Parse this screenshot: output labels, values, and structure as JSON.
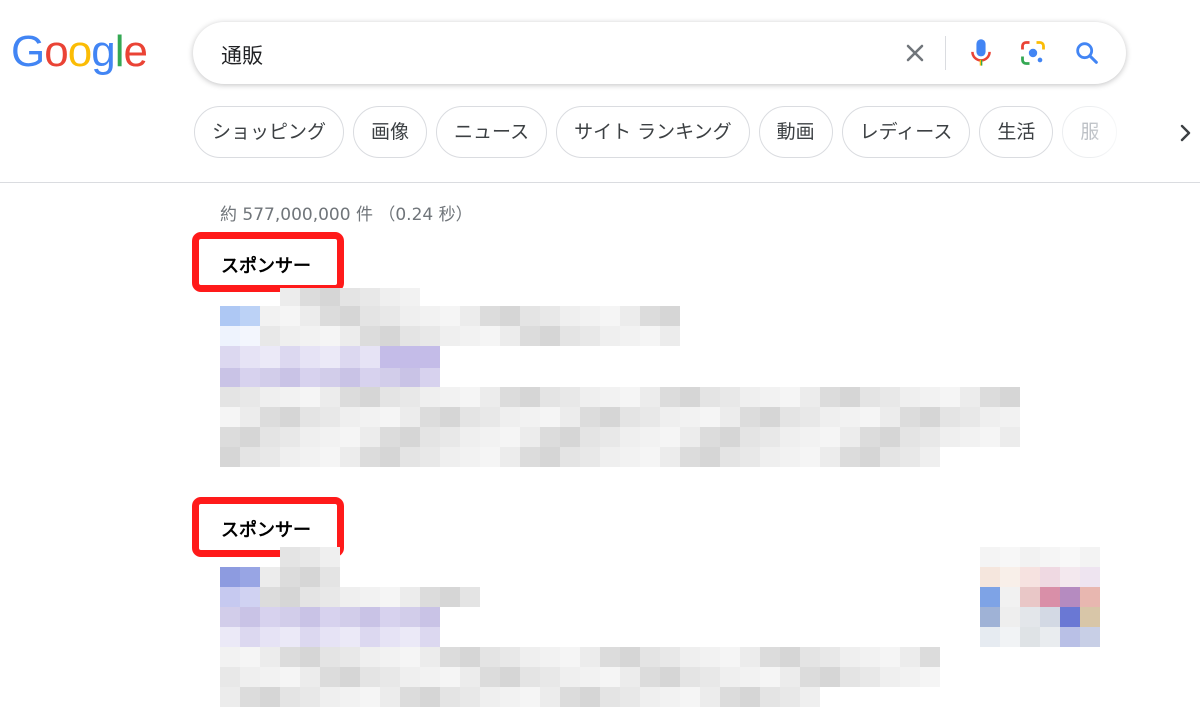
{
  "logo": {
    "letters": [
      "G",
      "o",
      "o",
      "g",
      "l",
      "e"
    ],
    "colors": [
      "#4285F4",
      "#EA4335",
      "#FBBC05",
      "#4285F4",
      "#34A853",
      "#EA4335"
    ]
  },
  "search": {
    "query": "通販",
    "icons": [
      "close-icon",
      "mic-icon",
      "lens-icon",
      "search-icon"
    ]
  },
  "chips": [
    "ショッピング",
    "画像",
    "ニュース",
    "サイト ランキング",
    "動画",
    "レディース",
    "生活",
    "服"
  ],
  "results": {
    "stats": "約 577,000,000 件 （0.24 秒）",
    "ads": [
      {
        "label": "スポンサー"
      },
      {
        "label": "スポンサー"
      }
    ]
  },
  "colors": {
    "highlight": "#ff1a1a",
    "link": "#1a0dab"
  }
}
